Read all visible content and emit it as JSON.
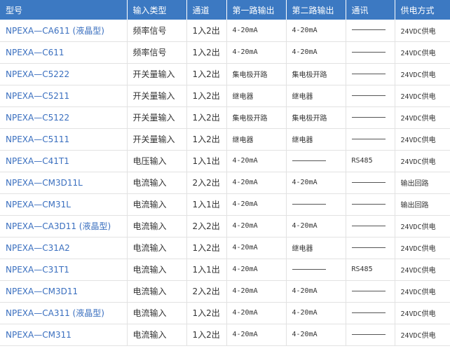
{
  "table": {
    "headers": [
      "型号",
      "输入类型",
      "通道",
      "第一路输出",
      "第二路输出",
      "通讯",
      "供电方式"
    ],
    "rows": [
      {
        "model": "NPEXA—CA611 (液晶型)",
        "input": "频率信号",
        "channel": "1入2出",
        "out1": "4-20mA",
        "out2": "4-20mA",
        "comm": "",
        "power": "24VDC供电"
      },
      {
        "model": "NPEXA—C611",
        "input": "频率信号",
        "channel": "1入2出",
        "out1": "4-20mA",
        "out2": "4-20mA",
        "comm": "",
        "power": "24VDC供电"
      },
      {
        "model": "NPEXA—C5222",
        "input": "开关量输入",
        "channel": "1入2出",
        "out1": "集电极开路",
        "out2": "集电极开路",
        "comm": "",
        "power": "24VDC供电"
      },
      {
        "model": "NPEXA—C5211",
        "input": "开关量输入",
        "channel": "1入2出",
        "out1": "继电器",
        "out2": "继电器",
        "comm": "",
        "power": "24VDC供电"
      },
      {
        "model": "NPEXA—C5122",
        "input": "开关量输入",
        "channel": "1入2出",
        "out1": "集电极开路",
        "out2": "集电极开路",
        "comm": "",
        "power": "24VDC供电"
      },
      {
        "model": "NPEXA—C5111",
        "input": "开关量输入",
        "channel": "1入2出",
        "out1": "继电器",
        "out2": "继电器",
        "comm": "",
        "power": "24VDC供电"
      },
      {
        "model": "NPEXA—C41T1",
        "input": "电压输入",
        "channel": "1入1出",
        "out1": "4-20mA",
        "out2": "",
        "comm": "RS485",
        "power": "24VDC供电"
      },
      {
        "model": "NPEXA—CM3D11L",
        "input": "电流输入",
        "channel": "2入2出",
        "out1": "4-20mA",
        "out2": "4-20mA",
        "comm": "",
        "power": "输出回路"
      },
      {
        "model": "NPEXA—CM31L",
        "input": "电流输入",
        "channel": "1入1出",
        "out1": "4-20mA",
        "out2": "",
        "comm": "",
        "power": "输出回路"
      },
      {
        "model": "NPEXA—CA3D11 (液晶型)",
        "input": "电流输入",
        "channel": "2入2出",
        "out1": "4-20mA",
        "out2": "4-20mA",
        "comm": "",
        "power": "24VDC供电"
      },
      {
        "model": "NPEXA—C31A2",
        "input": "电流输入",
        "channel": "1入2出",
        "out1": "4-20mA",
        "out2": "继电器",
        "comm": "",
        "power": "24VDC供电"
      },
      {
        "model": "NPEXA—C31T1",
        "input": "电流输入",
        "channel": "1入1出",
        "out1": "4-20mA",
        "out2": "",
        "comm": "RS485",
        "power": "24VDC供电"
      },
      {
        "model": "NPEXA—CM3D11",
        "input": "电流输入",
        "channel": "2入2出",
        "out1": "4-20mA",
        "out2": "4-20mA",
        "comm": "",
        "power": "24VDC供电"
      },
      {
        "model": "NPEXA—CA311 (液晶型)",
        "input": "电流输入",
        "channel": "1入2出",
        "out1": "4-20mA",
        "out2": "4-20mA",
        "comm": "",
        "power": "24VDC供电"
      },
      {
        "model": "NPEXA—CM311",
        "input": "电流输入",
        "channel": "1入2出",
        "out1": "4-20mA",
        "out2": "4-20mA",
        "comm": "",
        "power": "24VDC供电"
      }
    ]
  },
  "colors": {
    "header_bg": "#3c79c2",
    "header_text": "#ffffff",
    "link": "#3a6fbf",
    "border": "#e2e2e2",
    "text": "#333333"
  }
}
